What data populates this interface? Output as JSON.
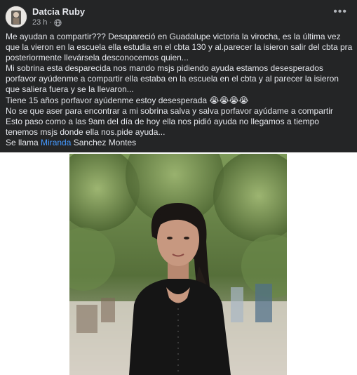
{
  "post": {
    "author": "Datcia Ruby",
    "timestamp": "23 h",
    "separator": "·",
    "audience_icon": "globe-icon",
    "more_icon": "more-options-icon",
    "paragraphs": [
      "Me ayudan a compartir??? Desapareció en Guadalupe victoria la virocha, es la última vez que la vieron en la escuela ella estudia en el cbta 130 y al.parecer la isieron salir del cbta pra posteriormente llevársela desconocemos quien...",
      "Mi sobrina esta desparecida nos mando msjs pidiendo ayuda estamos desesperados porfavor ayúdenme a compartir ella estaba en la escuela en el cbta y al parecer la isieron que saliera fuera y se la llevaron...",
      "Tiene 15 años porfavor ayúdenme estoy desesperada",
      "No se que aser para encontrar a mi sobrina salva y salva porfavor ayúdame a compartir",
      "Esto paso como a las 9am del día de hoy ella nos pidió ayuda no llegamos a tiempo tenemos msjs donde ella nos.pide ayuda..."
    ],
    "emoji_line": "😭😭😭😭",
    "name_prefix": "Se llama",
    "name_mention": "Miranda",
    "name_suffix": "Sanchez Montes"
  },
  "photo": {
    "subject": "teenage girl in black top",
    "colors": {
      "foliage": "#5f7f3f",
      "top": "#151515",
      "skin": "#c79880",
      "hair": "#1a1614"
    }
  },
  "colors": {
    "post_bg": "#242526",
    "text": "#e4e6eb",
    "secondary": "#b0b3b8",
    "link": "#4599ff"
  }
}
